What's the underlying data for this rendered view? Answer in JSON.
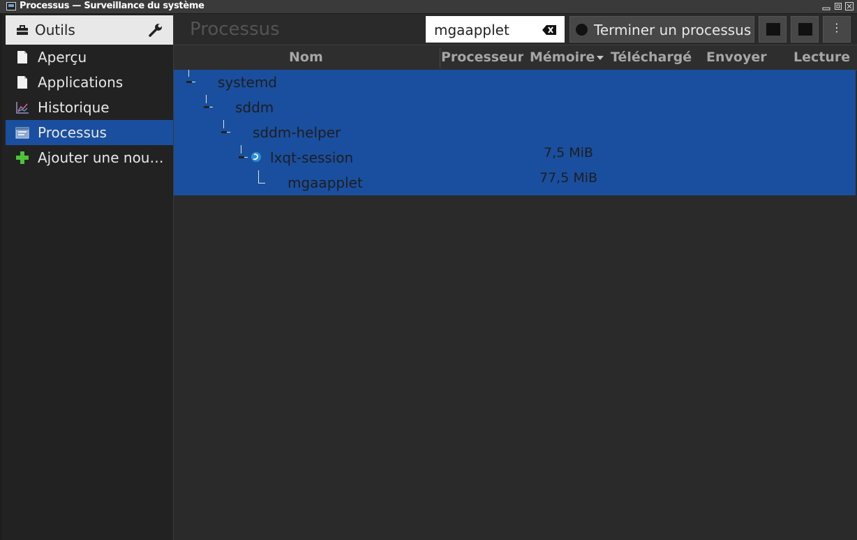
{
  "window": {
    "title": "Processus — Surveillance du système",
    "controls": [
      "minimize",
      "maximize",
      "close"
    ]
  },
  "sidebar": {
    "header_label": "Outils",
    "items": [
      {
        "label": "Aperçu",
        "icon": "document-icon",
        "active": false
      },
      {
        "label": "Applications",
        "icon": "document-icon",
        "active": false
      },
      {
        "label": "Historique",
        "icon": "chart-icon",
        "active": false
      },
      {
        "label": "Processus",
        "icon": "process-icon",
        "active": true
      },
      {
        "label": "Ajouter une nou…",
        "icon": "plus-icon",
        "active": false
      }
    ]
  },
  "main": {
    "title": "Processus",
    "search": {
      "value": "mgaapplet"
    },
    "toolbar": {
      "terminate_label": "Terminer un processus",
      "menu_label": "⋮"
    },
    "columns": [
      "Nom",
      "Processeur",
      "Mémoire",
      "Téléchargé",
      "Envoyer",
      "Lecture"
    ],
    "sort_column": "Mémoire",
    "processes": [
      {
        "name": "systemd",
        "depth": 0,
        "memory": ""
      },
      {
        "name": "sddm",
        "depth": 1,
        "memory": ""
      },
      {
        "name": "sddm-helper",
        "depth": 2,
        "memory": ""
      },
      {
        "name": "lxqt-session",
        "depth": 3,
        "memory": "7,5 MiB"
      },
      {
        "name": "mgaapplet",
        "depth": 4,
        "memory": "77,5 MiB"
      }
    ]
  },
  "colors": {
    "selection": "#1a4fa0",
    "background": "#2a2a2a",
    "sidebar": "#222222"
  }
}
